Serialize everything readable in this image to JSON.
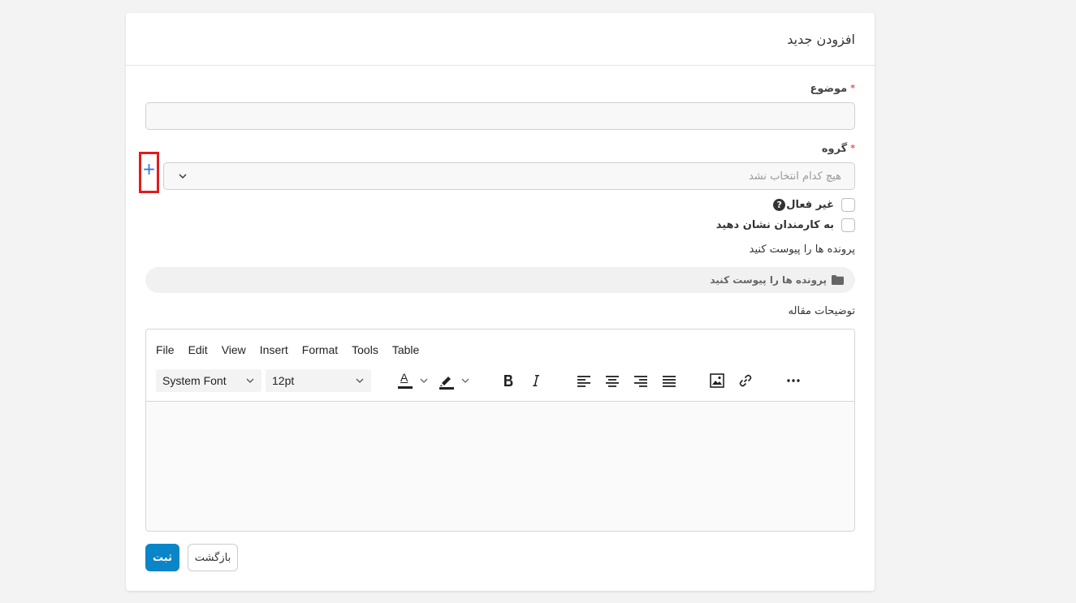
{
  "header": {
    "title": "افزودن جدید"
  },
  "subject": {
    "label": "موضوع",
    "required_mark": "*",
    "value": ""
  },
  "group": {
    "label": "گروه",
    "required_mark": "*",
    "placeholder": "هیچ کدام انتخاب نشد",
    "add_symbol": "+"
  },
  "checkboxes": {
    "inactive": {
      "label": "غیر فعال",
      "help_symbol": "?",
      "checked": false
    },
    "show_to_staff": {
      "label": "به کارمندان نشان دهید",
      "checked": false
    }
  },
  "attachments": {
    "label": "پرونده ها را پیوست کنید",
    "button_label": "پرونده ها را پیوست کنید"
  },
  "description": {
    "label": "توضیحات مقاله"
  },
  "editor": {
    "menu": [
      "File",
      "Edit",
      "View",
      "Insert",
      "Format",
      "Tools",
      "Table"
    ],
    "font_family": "System Font",
    "font_size": "12pt",
    "text_color_letter": "A"
  },
  "actions": {
    "submit_label": "ثبت",
    "back_label": "بازگشت"
  },
  "colors": {
    "primary": "#0a85c7",
    "highlight_border": "#e31b1b",
    "required": "#e55353"
  }
}
